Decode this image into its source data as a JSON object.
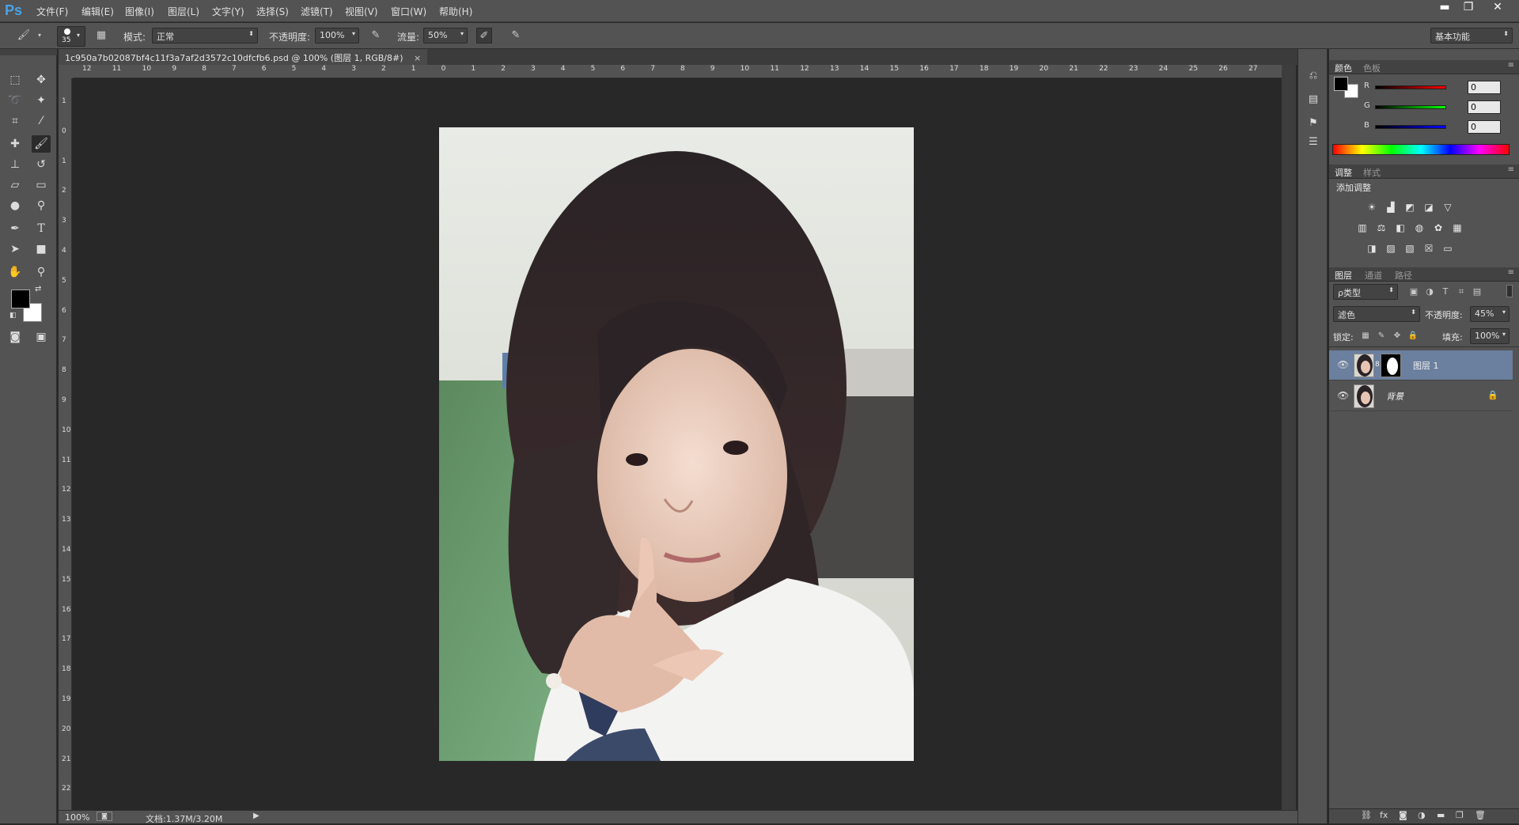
{
  "app": {
    "logo": "Ps"
  },
  "menu": [
    "文件(F)",
    "编辑(E)",
    "图像(I)",
    "图层(L)",
    "文字(Y)",
    "选择(S)",
    "滤镜(T)",
    "视图(V)",
    "窗口(W)",
    "帮助(H)"
  ],
  "window_buttons": {
    "minimize": "▬",
    "restore": "❐",
    "close": "✕"
  },
  "options": {
    "brush_size": "35",
    "mode_label": "模式:",
    "mode_value": "正常",
    "opacity_label": "不透明度:",
    "opacity_value": "100%",
    "flow_label": "流量:",
    "flow_value": "50%",
    "workspace": "基本功能"
  },
  "document": {
    "tab_title": "1c950a7b02087bf4c11f3a7af2d3572c10dfcfb6.psd @ 100% (图层 1, RGB/8#)",
    "tab_close": "×",
    "zoom": "100%",
    "doc_info": "文档:1.37M/3.20M"
  },
  "rulers": {
    "h": [
      "12",
      "11",
      "10",
      "9",
      "8",
      "7",
      "6",
      "5",
      "4",
      "3",
      "2",
      "1",
      "0",
      "1",
      "2",
      "3",
      "4",
      "5",
      "6",
      "7",
      "8",
      "9",
      "10",
      "11",
      "12",
      "13",
      "14",
      "15",
      "16",
      "17",
      "18",
      "19",
      "20",
      "21",
      "22",
      "23",
      "24",
      "25",
      "26",
      "27"
    ],
    "v": [
      "1",
      "0",
      "1",
      "2",
      "3",
      "4",
      "5",
      "6",
      "7",
      "8",
      "9",
      "10",
      "11",
      "12",
      "13",
      "14",
      "15",
      "16",
      "17",
      "18",
      "19",
      "20",
      "21",
      "22"
    ]
  },
  "color_panel": {
    "tabs": [
      "颜色",
      "色板"
    ],
    "r_label": "R",
    "g_label": "G",
    "b_label": "B",
    "r": "0",
    "g": "0",
    "b": "0",
    "foreground": "#000000",
    "background": "#ffffff"
  },
  "adjust_panel": {
    "tabs": [
      "调整",
      "样式"
    ],
    "title": "添加调整"
  },
  "layers_panel": {
    "tabs": [
      "图层",
      "通道",
      "路径"
    ],
    "filter_kind": "ρ类型",
    "blend_mode": "滤色",
    "opacity_label": "不透明度:",
    "opacity_value": "45%",
    "lock_label": "锁定:",
    "fill_label": "填充:",
    "fill_value": "100%",
    "layers": [
      {
        "name": "图层 1",
        "selected": true
      },
      {
        "name": "背景",
        "locked": true
      }
    ]
  }
}
